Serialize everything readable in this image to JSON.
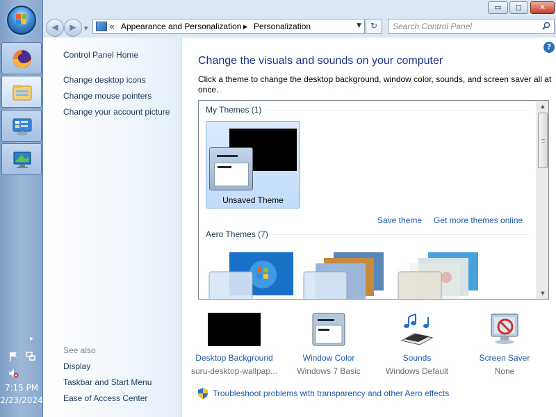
{
  "taskbar": {
    "clock_time": "7:15 PM",
    "clock_date": "2/23/2024",
    "pinned": [
      "firefox-icon",
      "file-explorer-icon",
      "control-panel-icon",
      "remote-desktop-icon"
    ]
  },
  "window": {
    "buttons": {
      "minimize": "▭",
      "maximize": "◻",
      "close": "✕"
    }
  },
  "navbar": {
    "back_glyph": "◀",
    "forward_glyph": "▶",
    "breadcrumb_sep": "«",
    "crumbs": [
      "Appearance and Personalization",
      "Personalization"
    ],
    "crumb_arrow": "▸",
    "dropdown_glyph": "▼",
    "refresh_glyph": "↻",
    "search_placeholder": "Search Control Panel"
  },
  "leftpane": {
    "home": "Control Panel Home",
    "links": [
      "Change desktop icons",
      "Change mouse pointers",
      "Change your account picture"
    ],
    "see_also_label": "See also",
    "see_also": [
      "Display",
      "Taskbar and Start Menu",
      "Ease of Access Center"
    ]
  },
  "main": {
    "help": "?",
    "heading": "Change the visuals and sounds on your computer",
    "description": "Click a theme to change the desktop background, window color, sounds, and screen saver all at once.",
    "my_themes_label": "My Themes (1)",
    "unsaved_theme": "Unsaved Theme",
    "save_theme": "Save theme",
    "get_more_themes": "Get more themes online",
    "aero_themes_label": "Aero Themes (7)"
  },
  "settings": [
    {
      "title": "Desktop Background",
      "value": "suru-desktop-wallpap..."
    },
    {
      "title": "Window Color",
      "value": "Windows 7 Basic"
    },
    {
      "title": "Sounds",
      "value": "Windows Default"
    },
    {
      "title": "Screen Saver",
      "value": "None"
    }
  ],
  "troubleshoot": "Troubleshoot problems with transparency and other Aero effects",
  "colors": {
    "link": "#1e5aa8",
    "heading": "#1e3287",
    "nav_text": "#1e395b"
  }
}
